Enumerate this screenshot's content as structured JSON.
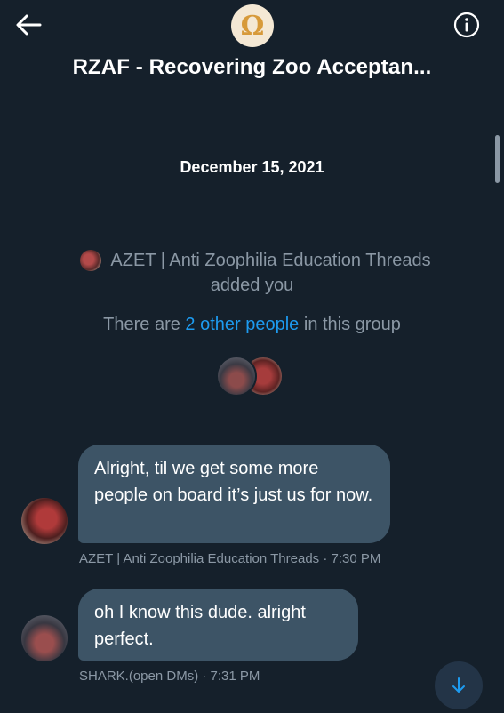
{
  "header": {
    "title": "RZAF - Recovering Zoo Acceptan...",
    "group_avatar_glyph": "Ω",
    "back_icon": "arrow-left-icon",
    "info_icon": "info-icon"
  },
  "conversation": {
    "date": "December 15, 2021",
    "added_by": "AZET | Anti Zoophilia Education Threads",
    "added_text": "added you",
    "group_info_prefix": "There are ",
    "group_info_link": "2 other people",
    "group_info_suffix": " in this group"
  },
  "messages": [
    {
      "text": "Alright, til we get some more people on board it’s just us for now.",
      "meta": "AZET | Anti Zoophilia Education Threads · 7:30 PM"
    },
    {
      "text": "oh I know this dude. alright perfect.",
      "meta": "SHARK.(open DMs) · 7:31 PM"
    }
  ],
  "scroll_down_icon": "arrow-down-icon",
  "colors": {
    "background": "#15202b",
    "bubble": "#3d5466",
    "secondary_text": "#8b98a5",
    "link": "#1d9bf0"
  }
}
